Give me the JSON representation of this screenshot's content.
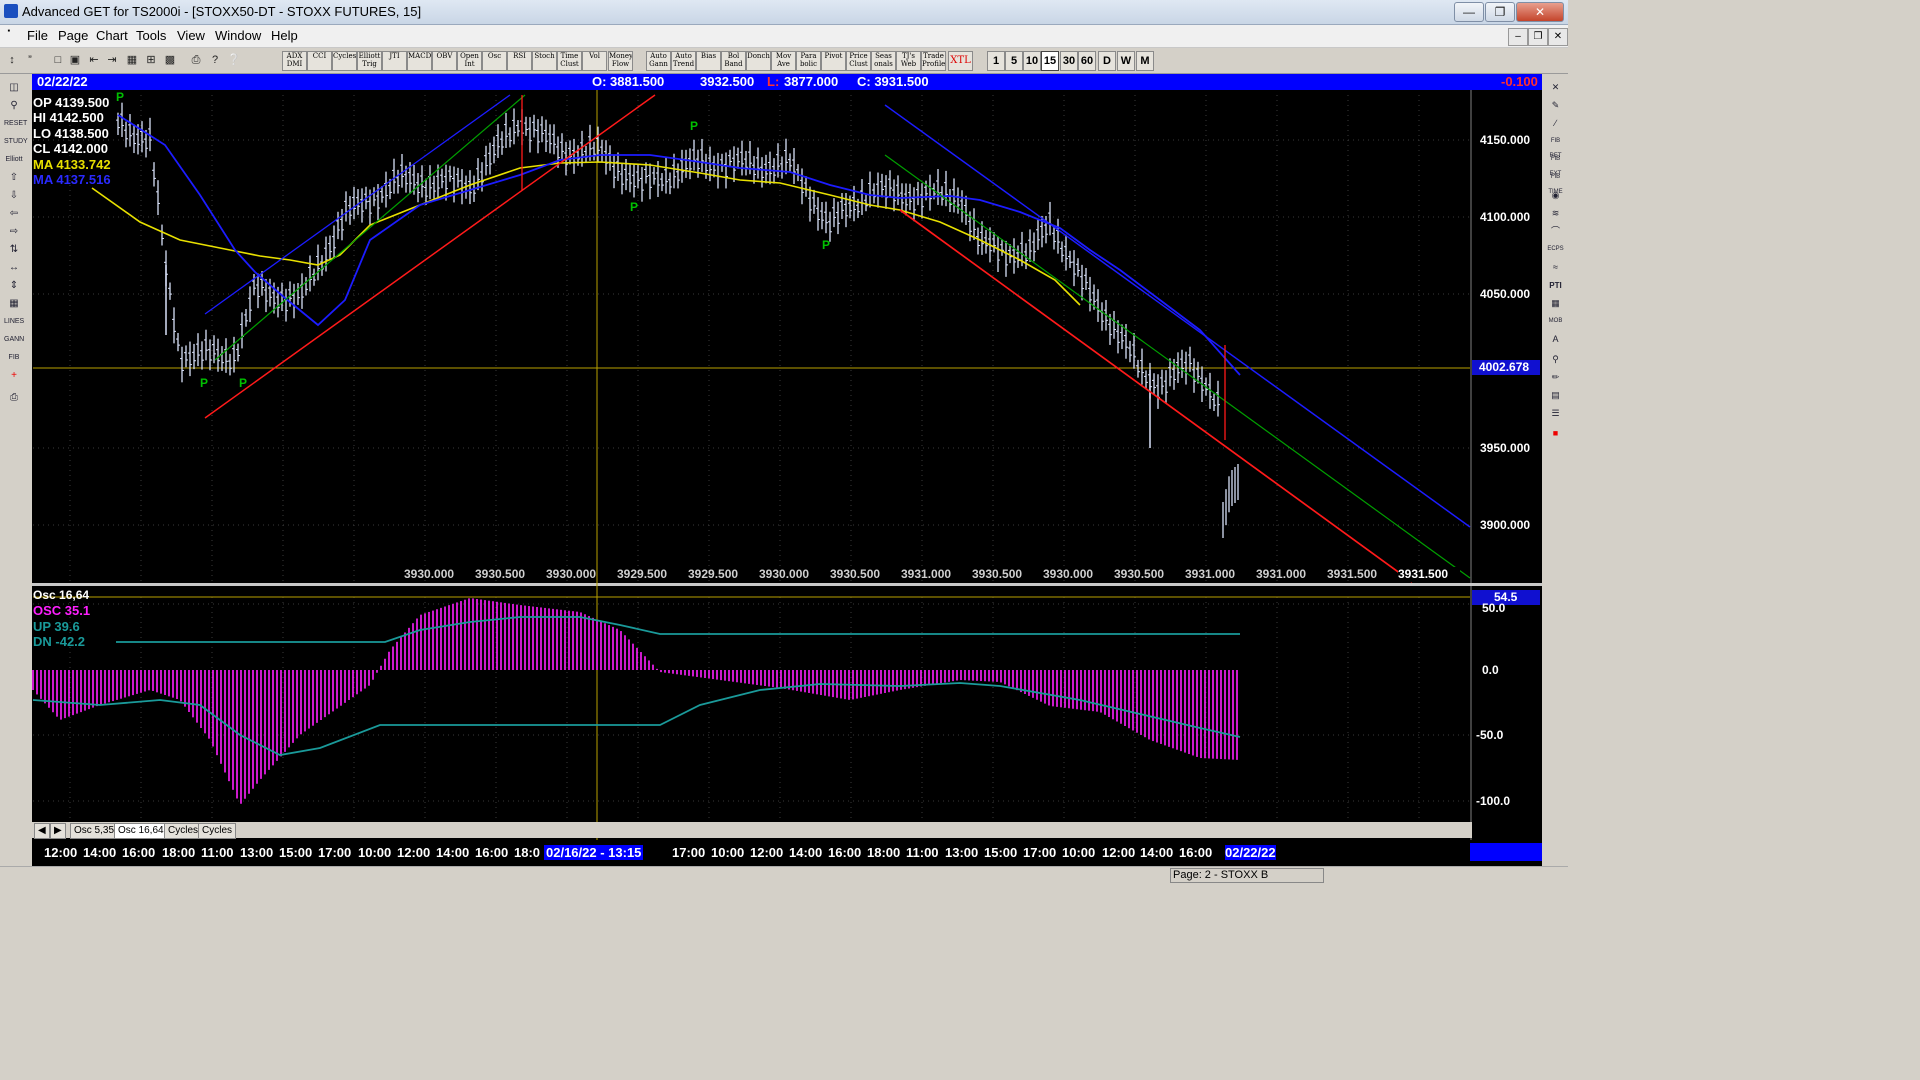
{
  "window": {
    "title": "Advanced GET for TS2000i - [STOXX50-DT - STOXX FUTURES, 15]"
  },
  "menu": [
    "File",
    "Page",
    "Chart",
    "Tools",
    "View",
    "Window",
    "Help"
  ],
  "toolbar": {
    "study_buttons": [
      "ADX DMI",
      "CCI",
      "Cycles",
      "Elliott Trig",
      "JTI",
      "MACD",
      "OBV",
      "Open Int",
      "Osc",
      "RSI",
      "Stoch",
      "Time Clust",
      "Vol",
      "Money Flow",
      "Auto Gann",
      "Auto Trend",
      "Bias",
      "Bol Band",
      "Donch",
      "Mov Ave",
      "Para bolic",
      "Pivot",
      "Price Clust",
      "Seas onals",
      "TJ's Web",
      "Trade Profile",
      "XTL"
    ],
    "interval_buttons": [
      "1",
      "5",
      "10",
      "15",
      "30",
      "60",
      "D",
      "W",
      "M"
    ]
  },
  "chart_header": {
    "date": "02/22/22",
    "open": "O: 3881.500",
    "high": "3932.500",
    "low_label": "L:",
    "low": "3877.000",
    "close": "C: 3931.500",
    "change": "-0.100"
  },
  "info_panel": {
    "op": "OP  4139.500",
    "hi": "HI   4142.500",
    "lo": "LO  4138.500",
    "cl": "CL  4142.000",
    "ma1": "MA  4133.742",
    "ma2": "MA  4137.516"
  },
  "price_axis": [
    "4150.000",
    "4100.000",
    "4050.000",
    "4002.678",
    "3950.000",
    "3900.000"
  ],
  "bottom_values": [
    "3930.000",
    "3930.500",
    "3930.000",
    "3929.500",
    "3929.500",
    "3930.000",
    "3930.500",
    "3931.000",
    "3930.500",
    "3930.000",
    "3930.500",
    "3931.000",
    "3931.000",
    "3931.500"
  ],
  "last_price": "3931.500",
  "pivot_labels": [
    "P",
    "P",
    "P",
    "P",
    "P",
    "P"
  ],
  "osc_panel": {
    "title": "Osc 16,64",
    "osc": "OSC 35.1",
    "up": "UP   39.6",
    "dn": "DN   -42.2",
    "current": "54.5",
    "axis": [
      "50.0",
      "0.0",
      "-50.0",
      "-100.0"
    ]
  },
  "tabs": [
    "Osc 5,35",
    "Osc 16,64",
    "Cycles",
    "Cycles"
  ],
  "time_axis": [
    "12:00",
    "14:00",
    "16:00",
    "18:00",
    "11:00",
    "13:00",
    "15:00",
    "17:00",
    "10:00",
    "12:00",
    "14:00",
    "16:00",
    "18:0",
    "02/16/22 - 13:15",
    "17:00",
    "10:00",
    "12:00",
    "14:00",
    "16:00",
    "18:00",
    "11:00",
    "13:00",
    "15:00",
    "17:00",
    "10:00",
    "12:00",
    "14:00",
    "16:00",
    "02/22/22"
  ],
  "status": {
    "page": "Page: 2 - STOXX B"
  },
  "colors": {
    "bar": "#d8e0f8",
    "ma_yellow": "#e8e000",
    "ma_blue": "#1c1cff",
    "channel_red": "#ff1a1a",
    "channel_green": "#00a000",
    "osc_magenta": "#ff20ff",
    "band_teal": "#1a9a9a",
    "pivot_green": "#00c000"
  }
}
